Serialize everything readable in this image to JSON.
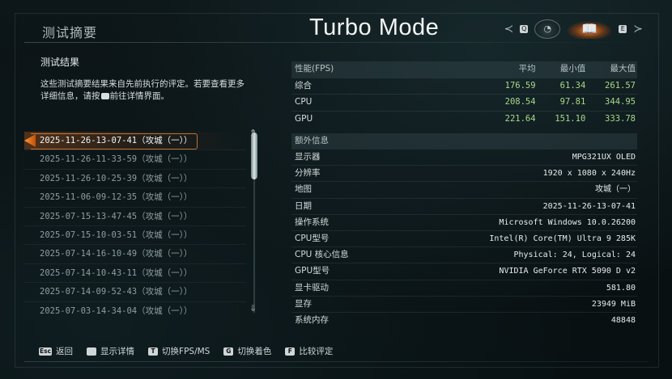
{
  "header": {
    "page_title": "测试摘要",
    "mode_title": "Turbo Mode",
    "left_key": "Q",
    "right_key": "E"
  },
  "summary": {
    "heading": "测试结果",
    "description_part1": "这些测试摘要结果来自先前执行的评定。若要查看更多详细信息，请按",
    "description_part2": "前往详情界面。"
  },
  "runs": [
    {
      "label": "2025-11-26-13-07-41（攻城（一））",
      "selected": true
    },
    {
      "label": "2025-11-26-11-33-59（攻城（一））",
      "selected": false
    },
    {
      "label": "2025-11-26-10-25-39（攻城（一））",
      "selected": false
    },
    {
      "label": "2025-11-06-09-12-35（攻城（一））",
      "selected": false
    },
    {
      "label": "2025-07-15-13-47-45（攻城（一））",
      "selected": false
    },
    {
      "label": "2025-07-15-10-03-51（攻城（一））",
      "selected": false
    },
    {
      "label": "2025-07-14-16-10-49（攻城（一））",
      "selected": false
    },
    {
      "label": "2025-07-14-10-43-11（攻城（一））",
      "selected": false
    },
    {
      "label": "2025-07-14-09-52-43（攻城（一））",
      "selected": false
    },
    {
      "label": "2025-07-03-14-34-04（攻城（一））",
      "selected": false
    }
  ],
  "performance": {
    "headers": [
      "性能(FPS)",
      "平均",
      "最小值",
      "最大值"
    ],
    "rows": [
      {
        "label": "综合",
        "avg": "176.59",
        "min": "61.34",
        "max": "261.57"
      },
      {
        "label": "CPU",
        "avg": "208.54",
        "min": "97.81",
        "max": "344.95"
      },
      {
        "label": "GPU",
        "avg": "221.64",
        "min": "151.10",
        "max": "333.78"
      }
    ]
  },
  "extra": {
    "heading": "额外信息",
    "rows": [
      {
        "key": "显示器",
        "value": "MPG321UX OLED"
      },
      {
        "key": "分辨率",
        "value": "1920 x 1080 x 240Hz"
      },
      {
        "key": "地图",
        "value": "攻城（一）"
      },
      {
        "key": "日期",
        "value": "2025-11-26-13-07-41"
      },
      {
        "key": "操作系统",
        "value": "Microsoft Windows 10.0.26200"
      },
      {
        "key": "CPU型号",
        "value": "Intel(R) Core(TM) Ultra 9 285K"
      },
      {
        "key": "CPU 核心信息",
        "value": "Physical: 24, Logical: 24"
      },
      {
        "key": "GPU型号",
        "value": "NVIDIA GeForce RTX 5090 D v2"
      },
      {
        "key": "显卡驱动",
        "value": "581.80"
      },
      {
        "key": "显存",
        "value": "23949 MiB"
      },
      {
        "key": "系统内存",
        "value": "48848"
      }
    ]
  },
  "footer": [
    {
      "key": "Esc",
      "label": "返回"
    },
    {
      "key": "",
      "label": "显示详情"
    },
    {
      "key": "T",
      "label": "切换FPS/MS"
    },
    {
      "key": "G",
      "label": "切换着色"
    },
    {
      "key": "F",
      "label": "比较评定"
    }
  ],
  "colors": {
    "accent": "#ff8a2a",
    "value_green": "#a8d98a",
    "background": "#0b1315"
  }
}
